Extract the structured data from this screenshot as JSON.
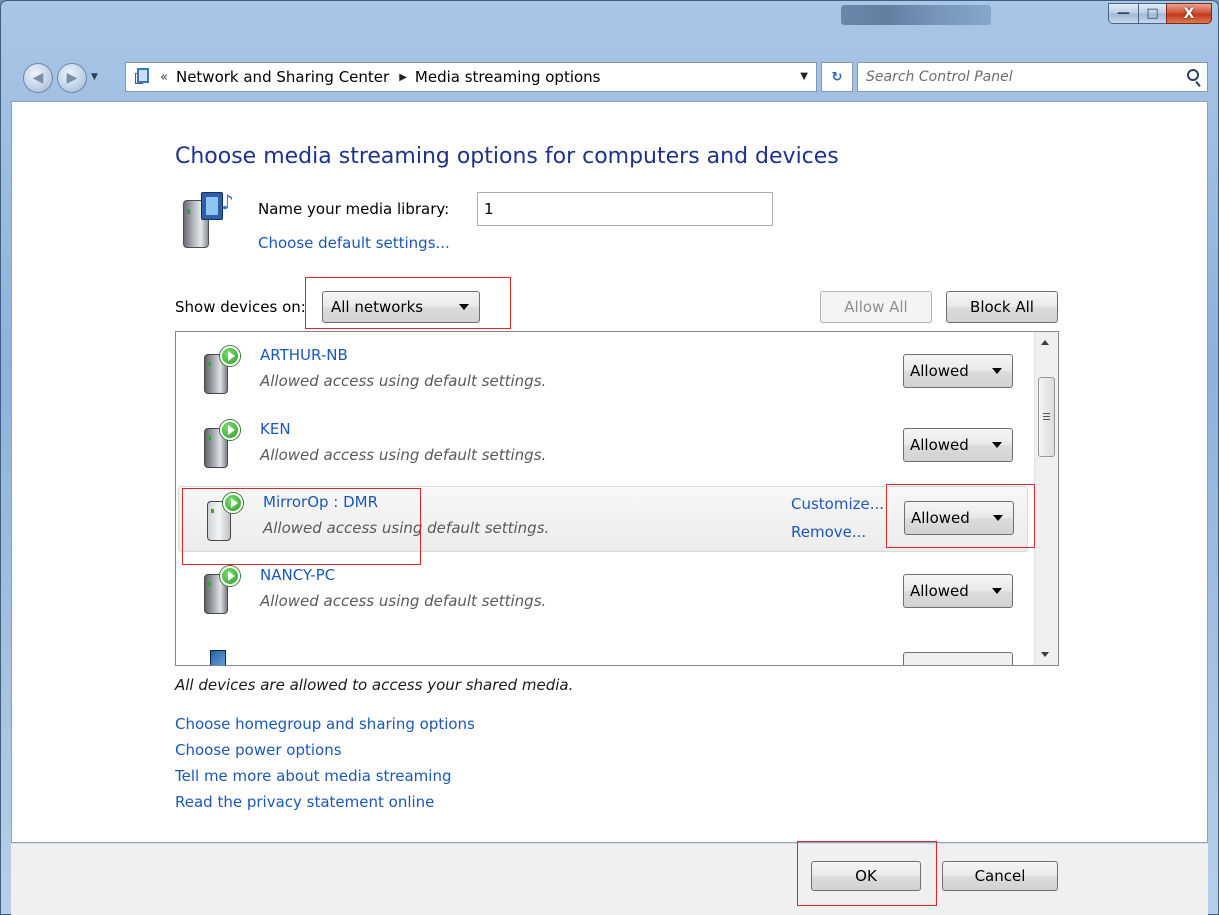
{
  "window": {
    "controls": {
      "minimize": "—",
      "maximize": "□",
      "close": "X"
    }
  },
  "navbar": {
    "breadcrumb_overflow": "«",
    "breadcrumb": [
      "Network and Sharing Center",
      "Media streaming options"
    ],
    "search_placeholder": "Search Control Panel",
    "icons": [
      "back-arrow-icon",
      "forward-arrow-icon",
      "control-panel-icon",
      "refresh-icon",
      "search-icon"
    ]
  },
  "main": {
    "heading": "Choose media streaming options for computers and devices",
    "library": {
      "label": "Name your media library:",
      "value": "1",
      "default_link": "Choose default settings..."
    },
    "show_devices": {
      "label": "Show devices on:",
      "selected": "All networks"
    },
    "allow_all": "Allow All",
    "block_all": "Block All",
    "devices": [
      {
        "name": "ARTHUR-NB",
        "desc": "Allowed access using default settings.",
        "status": "Allowed"
      },
      {
        "name": "KEN",
        "desc": "Allowed access using default settings.",
        "status": "Allowed"
      },
      {
        "name": "MirrorOp : DMR",
        "desc": "Allowed access using default settings.",
        "status": "Allowed",
        "customize": "Customize...",
        "remove": "Remove..."
      },
      {
        "name": "NANCY-PC",
        "desc": "Allowed access using default settings.",
        "status": "Allowed"
      }
    ],
    "summary": "All devices are allowed to access your shared media.",
    "links": [
      "Choose homegroup and sharing options",
      "Choose power options",
      "Tell me more about media streaming",
      "Read the privacy statement online"
    ]
  },
  "footer": {
    "ok": "OK",
    "cancel": "Cancel"
  },
  "colors": {
    "link": "#1a58b8",
    "heading": "#1e3287",
    "highlight": "#e0242c"
  }
}
